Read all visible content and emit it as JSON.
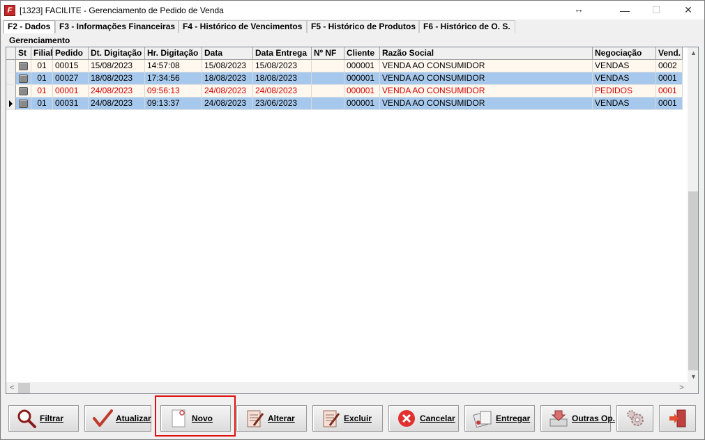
{
  "window": {
    "app_icon_letter": "F",
    "title": "[1323] FACILITE - Gerenciamento de Pedido de Venda",
    "resize_glyph": "↔",
    "minimize_glyph": "—",
    "maximize_glyph": "☐",
    "close_glyph": "✕"
  },
  "tabs": [
    {
      "label": "F2 - Dados",
      "active": true
    },
    {
      "label": "F3 - Informações Financeiras",
      "active": false
    },
    {
      "label": "F4 - Histórico de Vencimentos",
      "active": false
    },
    {
      "label": "F5 - Histórico de Produtos",
      "active": false
    },
    {
      "label": "F6 - Histórico de O. S.",
      "active": false
    }
  ],
  "group_label": "Gerenciamento",
  "grid": {
    "columns": [
      "St",
      "Filial",
      "Pedido",
      "Dt. Digitação",
      "Hr. Digitação",
      "Data",
      "Data Entrega",
      "Nº NF",
      "Cliente",
      "Razão Social",
      "Negociação",
      "Vend."
    ],
    "rows": [
      {
        "filial": "01",
        "pedido": "00015",
        "dt_digitacao": "15/08/2023",
        "hr_digitacao": "14:57:08",
        "data": "15/08/2023",
        "data_entrega": "15/08/2023",
        "nf": "",
        "cliente": "000001",
        "razao_social": "VENDA AO CONSUMIDOR",
        "negociacao": "VENDAS",
        "vend": "0002",
        "style": "plain",
        "current": false
      },
      {
        "filial": "01",
        "pedido": "00027",
        "dt_digitacao": "18/08/2023",
        "hr_digitacao": "17:34:56",
        "data": "18/08/2023",
        "data_entrega": "18/08/2023",
        "nf": "",
        "cliente": "000001",
        "razao_social": "VENDA AO CONSUMIDOR",
        "negociacao": "VENDAS",
        "vend": "0001",
        "style": "sel",
        "current": false
      },
      {
        "filial": "01",
        "pedido": "00001",
        "dt_digitacao": "24/08/2023",
        "hr_digitacao": "09:56:13",
        "data": "24/08/2023",
        "data_entrega": "24/08/2023",
        "nf": "",
        "cliente": "000001",
        "razao_social": "VENDA AO CONSUMIDOR",
        "negociacao": "PEDIDOS",
        "vend": "0001",
        "style": "red",
        "current": false
      },
      {
        "filial": "01",
        "pedido": "00031",
        "dt_digitacao": "24/08/2023",
        "hr_digitacao": "09:13:37",
        "data": "24/08/2023",
        "data_entrega": "23/06/2023",
        "nf": "",
        "cliente": "000001",
        "razao_social": "VENDA AO CONSUMIDOR",
        "negociacao": "VENDAS",
        "vend": "0001",
        "style": "sel",
        "current": true
      }
    ]
  },
  "scrollbar": {
    "up": "▲",
    "down": "▼",
    "left": "<",
    "right": ">"
  },
  "buttons": [
    {
      "label": "Filtrar",
      "icon": "magnifier-icon"
    },
    {
      "label": "Atualizar",
      "icon": "checkmark-icon"
    },
    {
      "label": "Novo",
      "icon": "new-document-icon"
    },
    {
      "label": "Alterar",
      "icon": "edit-document-icon"
    },
    {
      "label": "Excluir",
      "icon": "delete-document-icon"
    },
    {
      "label": "Cancelar",
      "icon": "cancel-circle-icon"
    },
    {
      "label": "Entregar",
      "icon": "deliver-icon"
    },
    {
      "label": "Outras Op.",
      "icon": "other-options-icon"
    },
    {
      "label": "",
      "icon": "settings-gears-icon"
    },
    {
      "label": "",
      "icon": "exit-door-icon"
    }
  ],
  "colors": {
    "selected_row": "#a6c8ec",
    "alert_text": "#d40000",
    "highlight_border": "#e01010"
  }
}
